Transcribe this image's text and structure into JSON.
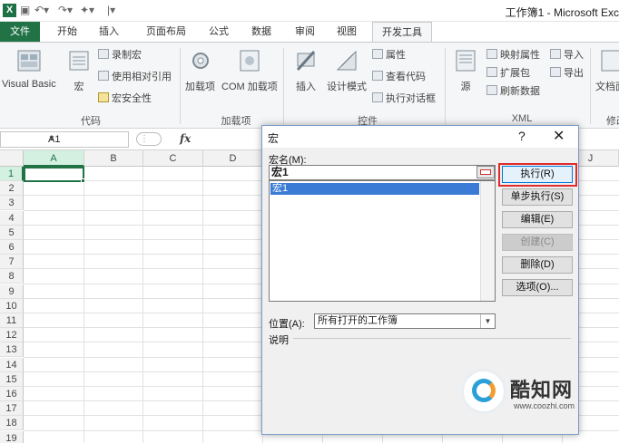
{
  "window": {
    "title": "工作簿1 - Microsoft Exc",
    "app_icon": "excel-icon"
  },
  "tabs": [
    "文件",
    "开始",
    "插入",
    "页面布局",
    "公式",
    "数据",
    "审阅",
    "视图",
    "开发工具"
  ],
  "ribbon": {
    "code": {
      "visual_basic": "Visual Basic",
      "macros": "宏",
      "record_macro": "录制宏",
      "relative_ref": "使用相对引用",
      "macro_security": "宏安全性",
      "label": "代码"
    },
    "addins": {
      "addins": "加载项",
      "com_addins": "COM 加载项",
      "label": "加载项"
    },
    "controls": {
      "insert": "插入",
      "design_mode": "设计模式",
      "properties": "属性",
      "view_code": "查看代码",
      "run_dialog": "执行对话框",
      "label": "控件"
    },
    "xml": {
      "source": "源",
      "map_props": "映射属性",
      "expansion": "扩展包",
      "refresh": "刷新数据",
      "import": "导入",
      "export": "导出",
      "label": "XML"
    },
    "modify": {
      "doc_panel": "文档面",
      "label": "修改"
    }
  },
  "formula_bar": {
    "name_box": "A1",
    "fx": "fx"
  },
  "sheet": {
    "columns": [
      "A",
      "B",
      "C",
      "D",
      "E",
      "F",
      "G",
      "H",
      "I",
      "J"
    ],
    "rows": [
      "1",
      "2",
      "3",
      "4",
      "5",
      "6",
      "7",
      "8",
      "9",
      "10",
      "11",
      "12",
      "13",
      "14",
      "15",
      "16",
      "17",
      "18",
      "19"
    ],
    "active_cell": "A1"
  },
  "macro_dialog": {
    "title": "宏",
    "help": "?",
    "close": "✕",
    "name_label": "宏名(M):",
    "name_value": "宏1",
    "macros": [
      "宏1"
    ],
    "buttons": {
      "run": "执行(R)",
      "step_into": "单步执行(S)",
      "edit": "编辑(E)",
      "create": "创建(C)",
      "delete": "删除(D)",
      "options": "选项(O)..."
    },
    "location_label": "位置(A):",
    "location_value": "所有打开的工作簿",
    "description_label": "说明"
  },
  "watermark": {
    "name": "酷知网",
    "url": "www.coozhi.com"
  },
  "colors": {
    "excel_green": "#217346",
    "highlight_red": "#e02b2b",
    "selection_blue": "#3a7bd5"
  }
}
